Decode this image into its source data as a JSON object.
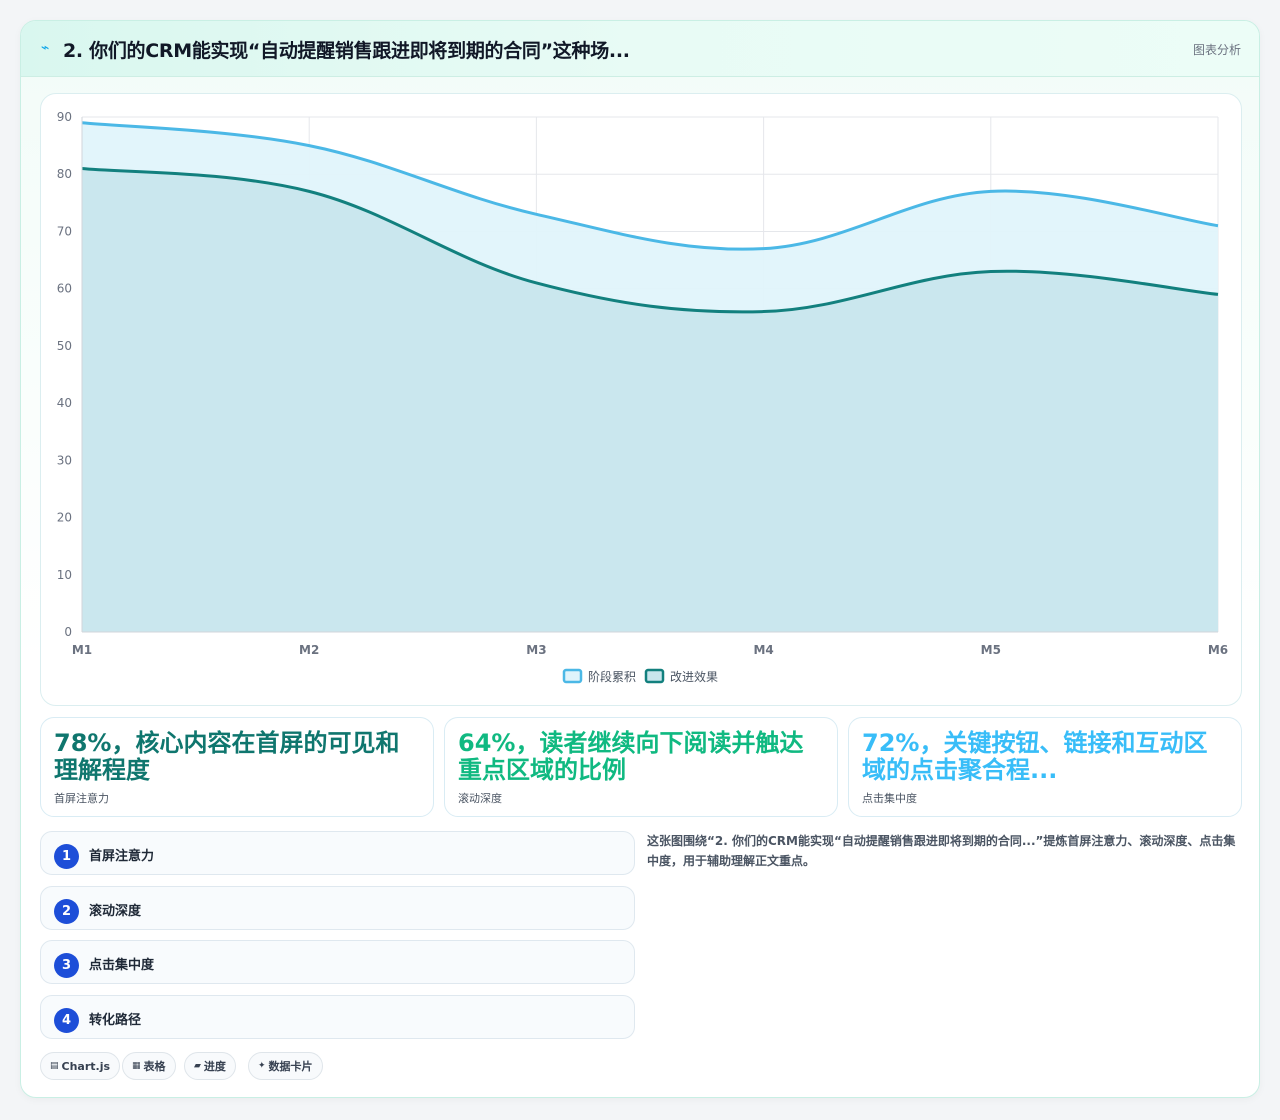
{
  "header": {
    "title": "2. 你们的CRM能实现“自动提醒销售跟进即将到期的合同”这种场...",
    "tag": "图表分析"
  },
  "chart_data": {
    "type": "area",
    "categories": [
      "M1",
      "M2",
      "M3",
      "M4",
      "M5",
      "M6"
    ],
    "series": [
      {
        "name": "阶段累积",
        "values": [
          89,
          85,
          73,
          67,
          77,
          71
        ],
        "color": "#4bb8e6",
        "fill": "#e0f4fb"
      },
      {
        "name": "改进效果",
        "values": [
          81,
          77,
          61,
          56,
          63,
          59
        ],
        "color": "#12807e",
        "fill": "#c8e6ed"
      }
    ],
    "ylim": [
      0,
      90
    ],
    "yticks": [
      0,
      10,
      20,
      30,
      40,
      50,
      60,
      70,
      80,
      90
    ],
    "grid": true,
    "legend": "bottom"
  },
  "stats": [
    {
      "value": "78%，核心内容在首屏的可见和理解程度",
      "label": "首屏注意力",
      "color": "#0f766e"
    },
    {
      "value": "64%，读者继续向下阅读并触达重点区域的比例",
      "label": "滚动深度",
      "color": "#10b981"
    },
    {
      "value": "72%，关键按钮、链接和互动区域的点击聚合程...",
      "label": "点击集中度",
      "color": "#38bdf8"
    }
  ],
  "steps": [
    {
      "num": "1",
      "label": "首屏注意力"
    },
    {
      "num": "2",
      "label": "滚动深度"
    },
    {
      "num": "3",
      "label": "点击集中度"
    },
    {
      "num": "4",
      "label": "转化路径"
    }
  ],
  "description": "这张图围绕“2. 你们的CRM能实现“自动提醒销售跟进即将到期的合同...”提炼首屏注意力、滚动深度、点击集中度，用于辅助理解正文重点。",
  "chips": [
    {
      "icon": "▤",
      "label": "Chart.js"
    },
    {
      "icon": "▦",
      "label": "表格"
    },
    {
      "icon": "▰",
      "label": "进度"
    },
    {
      "icon": "✦",
      "label": "数据卡片"
    }
  ]
}
